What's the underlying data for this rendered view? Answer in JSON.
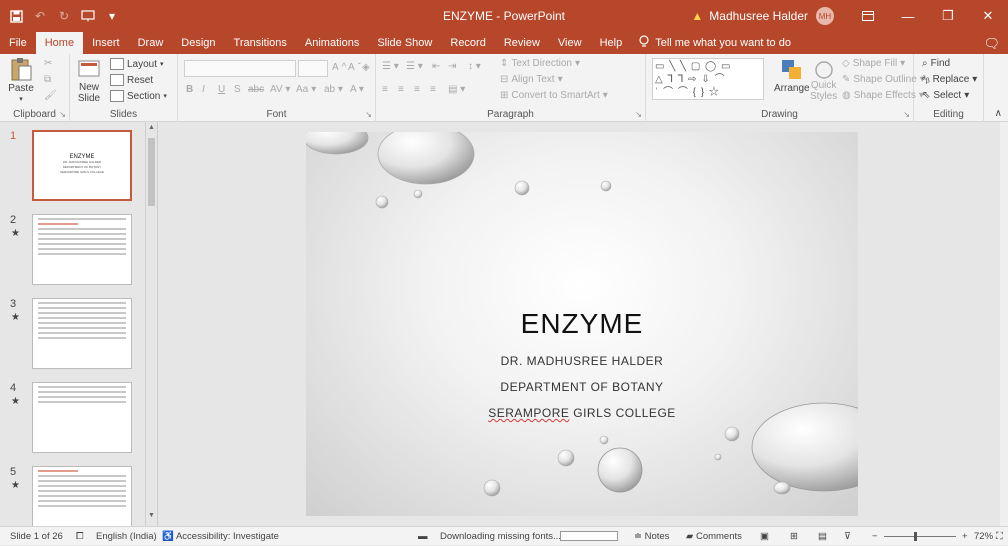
{
  "window": {
    "title": "ENZYME  -  PowerPoint",
    "user": "Madhusree Halder",
    "initials": "MH",
    "accent": "#b7472a"
  },
  "tabs": [
    "File",
    "Home",
    "Insert",
    "Draw",
    "Design",
    "Transitions",
    "Animations",
    "Slide Show",
    "Record",
    "Review",
    "View",
    "Help"
  ],
  "active_tab": "Home",
  "tell_me": "Tell me what you want to do",
  "ribbon": {
    "clipboard": {
      "paste": "Paste",
      "label": "Clipboard"
    },
    "slides": {
      "new_slide": "New",
      "new_slide2": "Slide",
      "layout": "Layout",
      "reset": "Reset",
      "section": "Section",
      "label": "Slides"
    },
    "font": {
      "label": "Font",
      "bold": "B",
      "italic": "I",
      "underline": "U",
      "strike": "S",
      "abc": "abc",
      "aa": "Aa",
      "grow": "A",
      "shrink": "A"
    },
    "paragraph": {
      "label": "Paragraph",
      "text_direction": "Text Direction",
      "align_text": "Align Text",
      "convert": "Convert to SmartArt"
    },
    "drawing": {
      "label": "Drawing",
      "arrange": "Arrange",
      "quick": "Quick",
      "styles": "Styles",
      "fill": "Shape Fill",
      "outline": "Shape Outline",
      "effects": "Shape Effects"
    },
    "editing": {
      "label": "Editing",
      "find": "Find",
      "replace": "Replace",
      "select": "Select"
    }
  },
  "thumbnails": [
    {
      "num": "1",
      "star": "",
      "title": "ENZYME",
      "lines": [
        "DR. MADHUSREE HALDER",
        "DEPARTMENT OF BOTANY",
        "SERAMPORE GIRLS COLLEGE"
      ]
    },
    {
      "num": "2",
      "star": "★"
    },
    {
      "num": "3",
      "star": "★"
    },
    {
      "num": "4",
      "star": "★"
    },
    {
      "num": "5",
      "star": "★"
    }
  ],
  "slide": {
    "title": "ENZYME",
    "line1": "DR. MADHUSREE HALDER",
    "line2": "DEPARTMENT OF BOTANY",
    "line3_a": "SERAMPORE",
    "line3_b": " GIRLS COLLEGE"
  },
  "status": {
    "slide_of": "Slide 1 of 26",
    "language": "English (India)",
    "accessibility": "Accessibility: Investigate",
    "downloading": "Downloading missing fonts...",
    "download_progress": 0,
    "notes": "Notes",
    "comments": "Comments",
    "zoom": "72%",
    "zoom_minus": "−",
    "zoom_plus": "+"
  }
}
